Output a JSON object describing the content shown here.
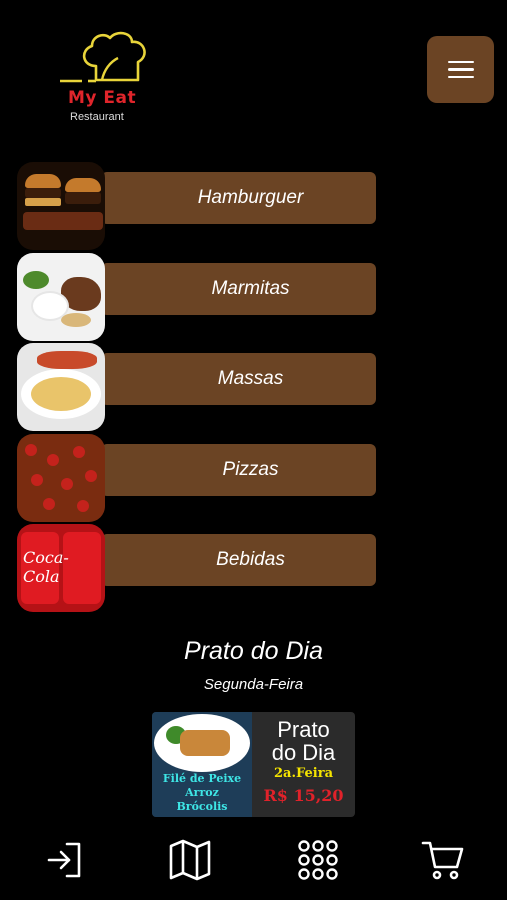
{
  "header": {
    "logo_name": "My Eat",
    "logo_sub": "Restaurant",
    "menu_icon": "hamburger-menu-icon",
    "colors": {
      "accent": "#6b4424",
      "logo_red": "#e0252b",
      "logo_yellow": "#e8d43a"
    }
  },
  "categories": [
    {
      "label": "Hamburguer",
      "image": "hamburger-photo"
    },
    {
      "label": "Marmitas",
      "image": "marmita-photo"
    },
    {
      "label": "Massas",
      "image": "pasta-photo"
    },
    {
      "label": "Pizzas",
      "image": "pizza-photo"
    },
    {
      "label": "Bebidas",
      "image": "coca-cola-photo"
    }
  ],
  "prato_do_dia": {
    "title": "Prato do Dia",
    "day": "Segunda-Feira",
    "card": {
      "items": [
        "Filé de Peixe",
        "Arroz",
        "Brócolis"
      ],
      "title_line1": "Prato",
      "title_line2": "do Dia",
      "day": "2a.Feira",
      "price": "R$ 15,20",
      "brand_text": "Coca-Cola"
    }
  },
  "bottom_nav": [
    {
      "name": "login",
      "icon": "login-icon"
    },
    {
      "name": "map",
      "icon": "map-icon"
    },
    {
      "name": "menu-grid",
      "icon": "grid-icon"
    },
    {
      "name": "cart",
      "icon": "cart-icon"
    }
  ]
}
